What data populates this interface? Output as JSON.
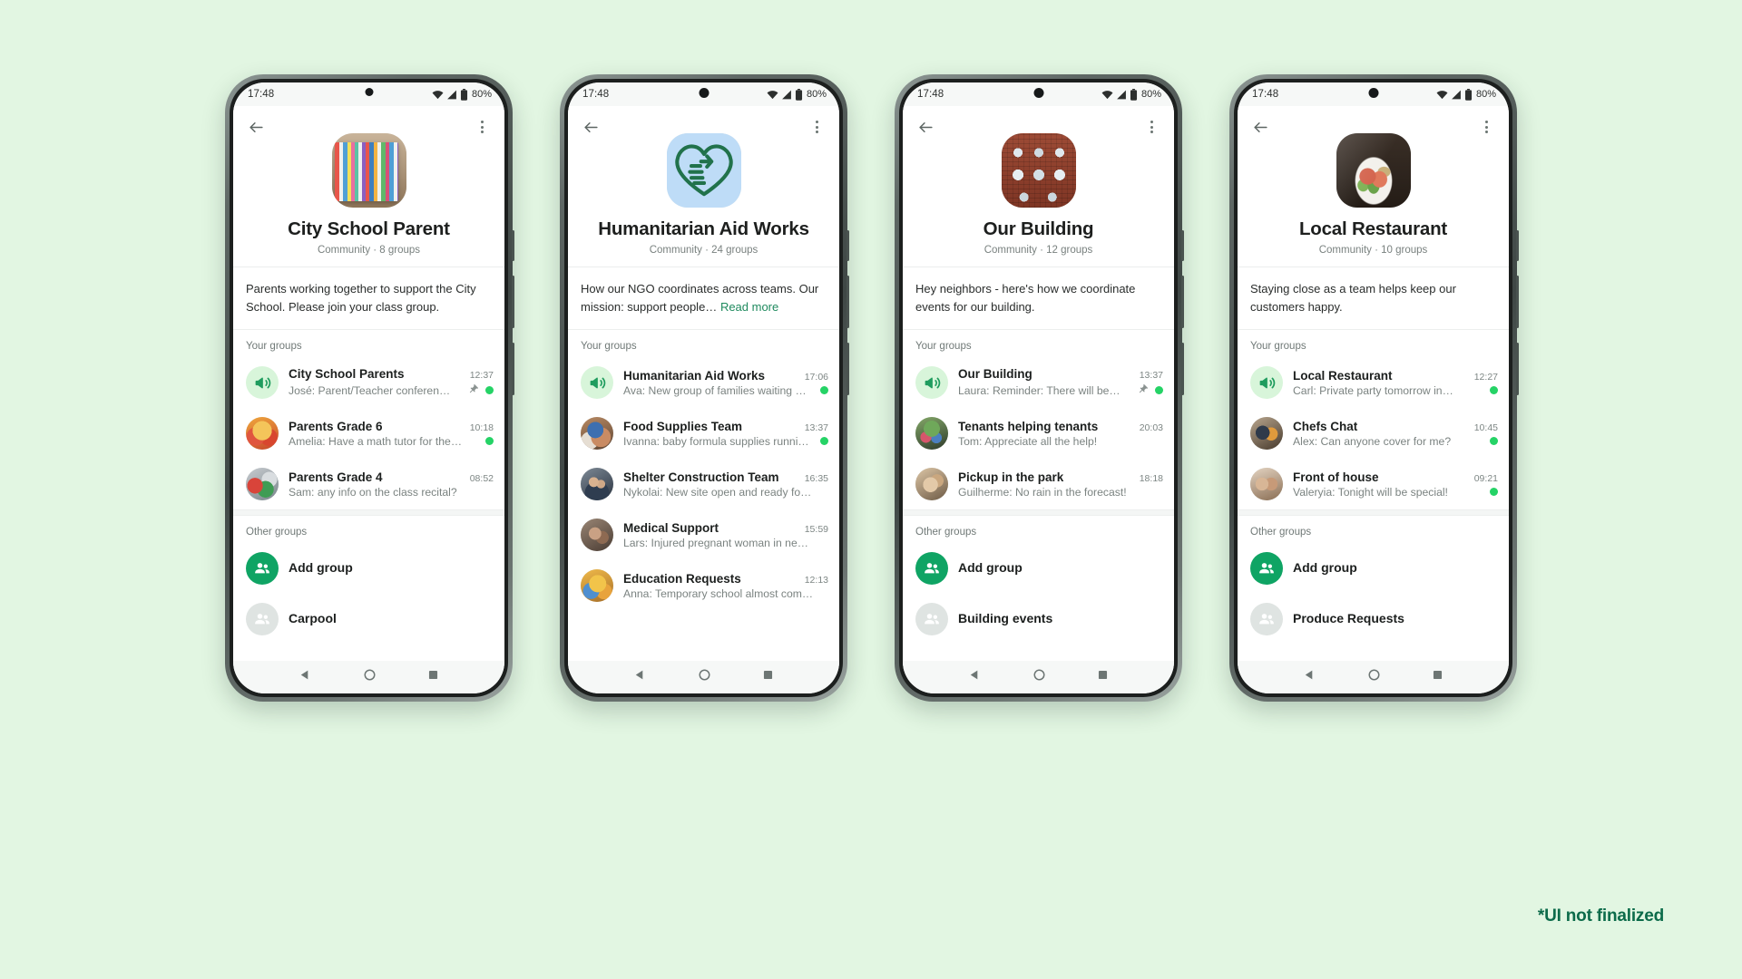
{
  "page": {
    "background_color": "#e2f6e2",
    "footnote": "*UI not finalized",
    "accent_green": "#0fa464",
    "link_green": "#1f8a5e",
    "unread_green": "#25d366"
  },
  "status_bar": {
    "time": "17:48",
    "battery": "80%"
  },
  "labels": {
    "your_groups": "Your groups",
    "other_groups": "Other groups",
    "read_more": "Read more",
    "add_group": "Add group"
  },
  "phones": [
    {
      "id": "city-school-parent",
      "avatar_kind": "books",
      "title": "City School Parent",
      "subtitle": "Community · 8 groups",
      "description": "Parents working together to support the City School. Please join your class group.",
      "has_read_more": false,
      "your_groups": [
        {
          "avatar_kind": "announce",
          "title": "City School Parents",
          "message": "José: Parent/Teacher conferen…",
          "time": "12:37",
          "pinned": true,
          "unread": true
        },
        {
          "avatar_kind": "photo-grade6",
          "title": "Parents Grade 6",
          "message": "Amelia: Have a math tutor for the…",
          "time": "10:18",
          "pinned": false,
          "unread": true
        },
        {
          "avatar_kind": "photo-grade4",
          "title": "Parents Grade 4",
          "message": "Sam: any info on the class recital?",
          "time": "08:52",
          "pinned": false,
          "unread": false
        }
      ],
      "other_groups": [
        {
          "avatar_kind": "add",
          "title": "Add group"
        },
        {
          "avatar_kind": "placeholder",
          "title": "Carpool"
        }
      ]
    },
    {
      "id": "humanitarian-aid-works",
      "avatar_kind": "heart-hand",
      "title": "Humanitarian Aid Works",
      "subtitle": "Community · 24 groups",
      "description": "How our NGO coordinates across teams. Our mission: support people…",
      "has_read_more": true,
      "your_groups": [
        {
          "avatar_kind": "announce",
          "title": "Humanitarian Aid Works",
          "message": "Ava: New group of families waiting …",
          "time": "17:06",
          "pinned": false,
          "unread": true
        },
        {
          "avatar_kind": "photo-food",
          "title": "Food Supplies Team",
          "message": "Ivanna: baby formula supplies running …",
          "time": "13:37",
          "pinned": false,
          "unread": true
        },
        {
          "avatar_kind": "photo-shelter",
          "title": "Shelter Construction Team",
          "message": "Nykolai: New site open and ready for …",
          "time": "16:35",
          "pinned": false,
          "unread": false
        },
        {
          "avatar_kind": "photo-medical",
          "title": "Medical Support",
          "message": "Lars: Injured pregnant woman in need…",
          "time": "15:59",
          "pinned": false,
          "unread": false
        },
        {
          "avatar_kind": "photo-education",
          "title": "Education Requests",
          "message": "Anna: Temporary school almost comp…",
          "time": "12:13",
          "pinned": false,
          "unread": false
        }
      ],
      "other_groups": []
    },
    {
      "id": "our-building",
      "avatar_kind": "building",
      "title": "Our Building",
      "subtitle": "Community · 12 groups",
      "description": "Hey neighbors - here's how we coordinate events for our building.",
      "has_read_more": false,
      "your_groups": [
        {
          "avatar_kind": "announce",
          "title": "Our Building",
          "message": "Laura: Reminder: There will be…",
          "time": "13:37",
          "pinned": true,
          "unread": true
        },
        {
          "avatar_kind": "photo-tenants",
          "title": "Tenants helping tenants",
          "message": "Tom: Appreciate all the help!",
          "time": "20:03",
          "pinned": false,
          "unread": false
        },
        {
          "avatar_kind": "photo-pickup",
          "title": "Pickup in the park",
          "message": "Guilherme: No rain in the forecast!",
          "time": "18:18",
          "pinned": false,
          "unread": false
        }
      ],
      "other_groups": [
        {
          "avatar_kind": "add",
          "title": "Add group"
        },
        {
          "avatar_kind": "placeholder",
          "title": "Building events"
        }
      ]
    },
    {
      "id": "local-restaurant",
      "avatar_kind": "food",
      "title": "Local Restaurant",
      "subtitle": "Community · 10 groups",
      "description": "Staying close as a team helps keep our customers happy.",
      "has_read_more": false,
      "your_groups": [
        {
          "avatar_kind": "announce",
          "title": "Local Restaurant",
          "message": "Carl: Private party tomorrow in…",
          "time": "12:27",
          "pinned": false,
          "unread": true
        },
        {
          "avatar_kind": "photo-chefs",
          "title": "Chefs Chat",
          "message": "Alex: Can anyone cover for me?",
          "time": "10:45",
          "pinned": false,
          "unread": true
        },
        {
          "avatar_kind": "photo-front",
          "title": "Front of house",
          "message": "Valeryia: Tonight will be special!",
          "time": "09:21",
          "pinned": false,
          "unread": true
        }
      ],
      "other_groups": [
        {
          "avatar_kind": "add",
          "title": "Add group"
        },
        {
          "avatar_kind": "placeholder",
          "title": "Produce Requests"
        }
      ]
    }
  ]
}
